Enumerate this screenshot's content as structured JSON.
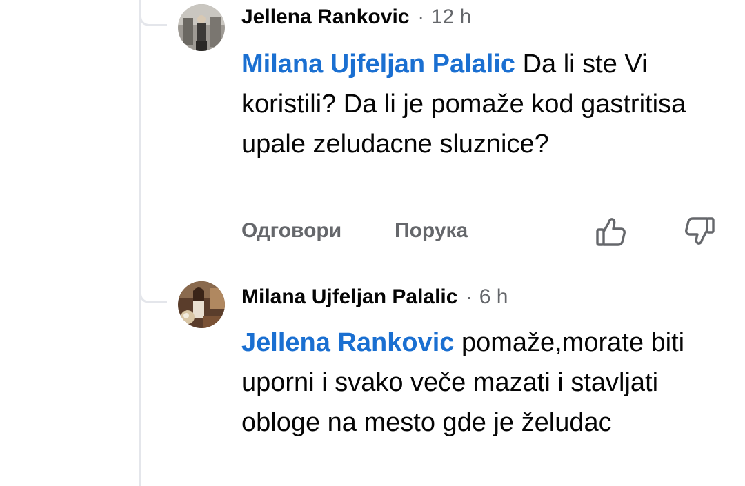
{
  "comments": [
    {
      "author": "Jellena Rankovic",
      "separator": "·",
      "time": "12 h",
      "mention": "Milana Ujfeljan Palalic",
      "text": "Da li ste Vi koristili? Da li je pomaže kod gastritisa upale zeludacne sluznice?",
      "avatar_icon": "profile-photo"
    },
    {
      "author": "Milana Ujfeljan Palalic",
      "separator": "·",
      "time": "6 h",
      "mention": "Jellena Rankovic",
      "text": "pomaže,morate biti uporni i svako veče mazati i stavljati obloge na mesto gde je želudac",
      "avatar_icon": "profile-photo"
    }
  ],
  "actions": {
    "reply_label": "Одговори",
    "message_label": "Порука",
    "like_icon": "thumbs-up-icon",
    "dislike_icon": "thumbs-down-icon"
  }
}
